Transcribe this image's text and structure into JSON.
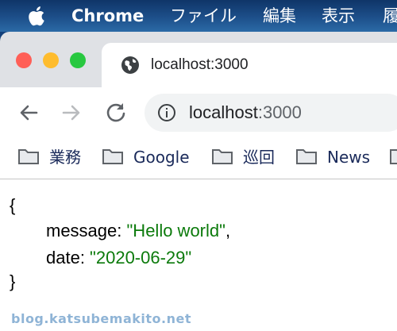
{
  "menubar": {
    "app_name": "Chrome",
    "items": [
      "ファイル",
      "編集",
      "表示",
      "履"
    ]
  },
  "window": {
    "tab": {
      "title": "localhost:3000",
      "icon": "globe-icon"
    }
  },
  "toolbar": {
    "back_icon": "back-arrow-icon",
    "forward_icon": "forward-arrow-icon",
    "reload_icon": "reload-icon",
    "omnibox": {
      "host": "localhost",
      "port": ":3000",
      "security_icon": "info-icon"
    }
  },
  "bookmarks": [
    {
      "label": "業務"
    },
    {
      "label": "Google"
    },
    {
      "label": "巡回"
    },
    {
      "label": "News"
    },
    {
      "label": ""
    }
  ],
  "page": {
    "open_brace": "{",
    "message_key": "message: ",
    "message_value": "\"Hello world\"",
    "message_sep": ",",
    "date_key": "date: ",
    "date_value": "\"2020-06-29\"",
    "close_brace": "}"
  },
  "watermark": "blog.katsubemakito.net",
  "colors": {
    "string_value": "#0b7a0b",
    "traffic_red": "#ff5f57",
    "traffic_yellow": "#febc2e",
    "traffic_green": "#28c840"
  }
}
